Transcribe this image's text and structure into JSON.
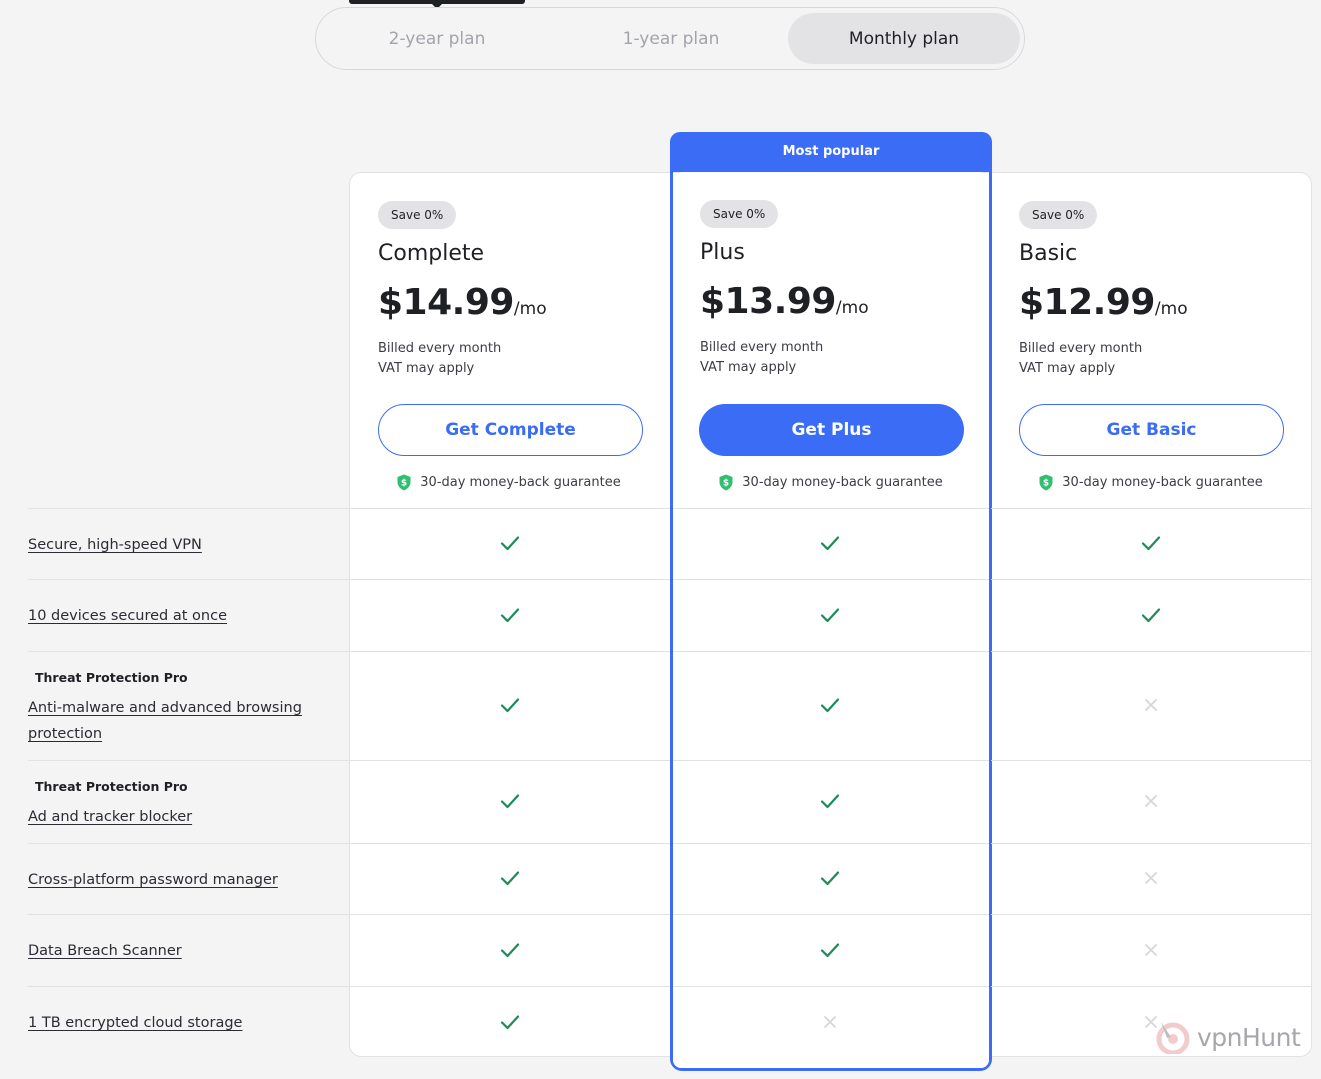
{
  "billing_toggle": {
    "options": [
      "2-year plan",
      "1-year plan",
      "Monthly plan"
    ],
    "selected": "Monthly plan"
  },
  "highlight": {
    "label": "Most popular"
  },
  "plans": [
    {
      "badge": "Save 0%",
      "name": "Complete",
      "price": "$14.99",
      "per": "/mo",
      "billing": "Billed every month",
      "vat": "VAT may apply",
      "cta": "Get Complete",
      "guarantee": "30-day money-back guarantee"
    },
    {
      "badge": "Save 0%",
      "name": "Plus",
      "price": "$13.99",
      "per": "/mo",
      "billing": "Billed every month",
      "vat": "VAT may apply",
      "cta": "Get Plus",
      "guarantee": "30-day money-back guarantee"
    },
    {
      "badge": "Save 0%",
      "name": "Basic",
      "price": "$12.99",
      "per": "/mo",
      "billing": "Billed every month",
      "vat": "VAT may apply",
      "cta": "Get Basic",
      "guarantee": "30-day money-back guarantee"
    }
  ],
  "features": [
    {
      "sublabel": "",
      "label": "Secure, high-speed VPN",
      "included": [
        true,
        true,
        true
      ]
    },
    {
      "sublabel": "",
      "label": "10 devices secured at once",
      "included": [
        true,
        true,
        true
      ]
    },
    {
      "sublabel": "Threat Protection Pro",
      "label": "Anti-malware and advanced browsing protection",
      "included": [
        true,
        true,
        false
      ]
    },
    {
      "sublabel": "Threat Protection Pro",
      "label": "Ad and tracker blocker",
      "included": [
        true,
        true,
        false
      ]
    },
    {
      "sublabel": "",
      "label": "Cross-platform password manager",
      "included": [
        true,
        true,
        false
      ]
    },
    {
      "sublabel": "",
      "label": "Data Breach Scanner",
      "included": [
        true,
        true,
        false
      ]
    },
    {
      "sublabel": "",
      "label": "1 TB encrypted cloud storage",
      "included": [
        true,
        false,
        false
      ]
    }
  ],
  "colors": {
    "accent": "#3b6cf5",
    "check": "#1e8a5a",
    "cross": "#d6d6da",
    "shield": "#2fbf71"
  },
  "watermark": "vpnHunt"
}
